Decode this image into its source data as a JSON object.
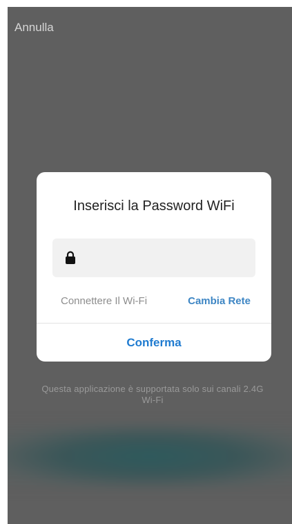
{
  "header": {
    "cancel_label": "Annulla"
  },
  "dialog": {
    "title": "Inserisci la Password WiFi",
    "password_field": {
      "value": "",
      "placeholder": "",
      "icon": "lock-icon"
    },
    "connect_label": "Connettere Il Wi-Fi",
    "change_network_label": "Cambia Rete",
    "confirm_label": "Conferma"
  },
  "notice": {
    "line1": "Questa applicazione è supportata solo sui canali 2.4G",
    "line2": "Wi-Fi"
  },
  "colors": {
    "overlay": "#5f5f5f",
    "accent": "#1f7bd0",
    "secondary_accent": "#3e86c4"
  }
}
